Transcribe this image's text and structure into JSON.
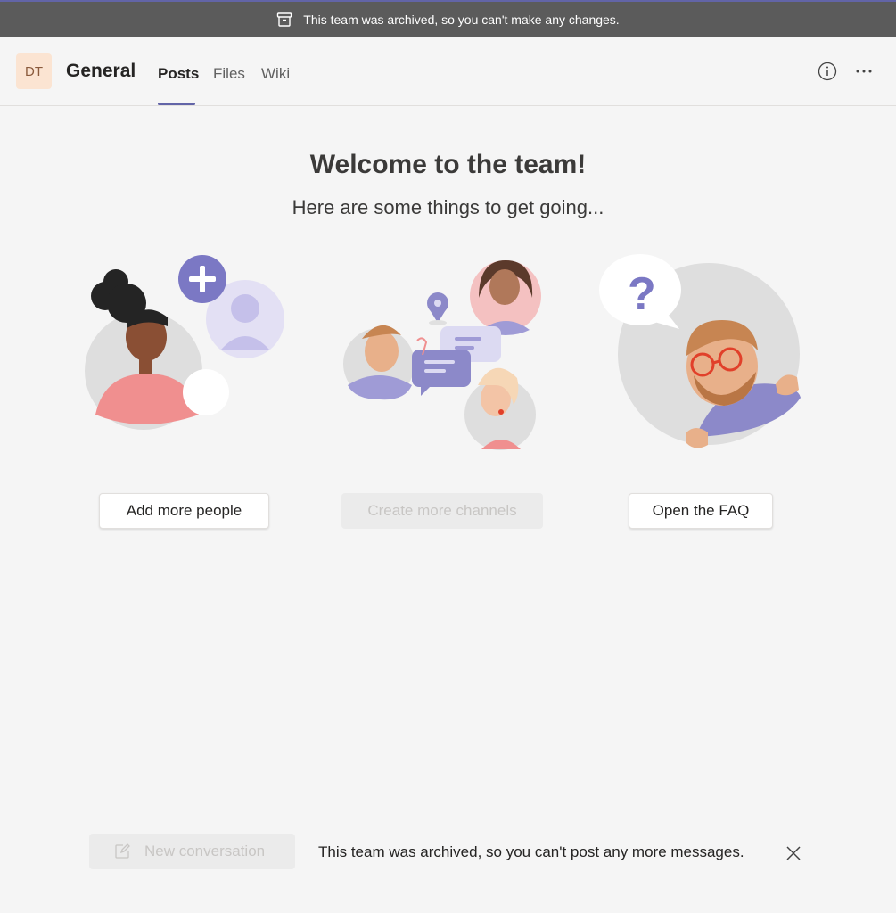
{
  "banner": {
    "text": "This team was archived, so you can't make any changes.",
    "icon": "archive-icon"
  },
  "header": {
    "avatar_initials": "DT",
    "channel_name": "General",
    "tabs": [
      {
        "label": "Posts",
        "active": true
      },
      {
        "label": "Files",
        "active": false
      },
      {
        "label": "Wiki",
        "active": false
      }
    ],
    "icons": [
      "info-icon",
      "more-options-icon"
    ]
  },
  "welcome": {
    "title": "Welcome to the team!",
    "subtitle": "Here are some things to get going..."
  },
  "actions": [
    {
      "label": "Add more people",
      "enabled": true
    },
    {
      "label": "Create more channels",
      "enabled": false
    },
    {
      "label": "Open the FAQ",
      "enabled": true
    }
  ],
  "footer": {
    "new_conversation_label": "New conversation",
    "archived_message": "This team was archived, so you can't post any more messages."
  },
  "colors": {
    "accent": "#6264a7",
    "banner": "#5b5b5b",
    "background": "#f5f5f5"
  }
}
